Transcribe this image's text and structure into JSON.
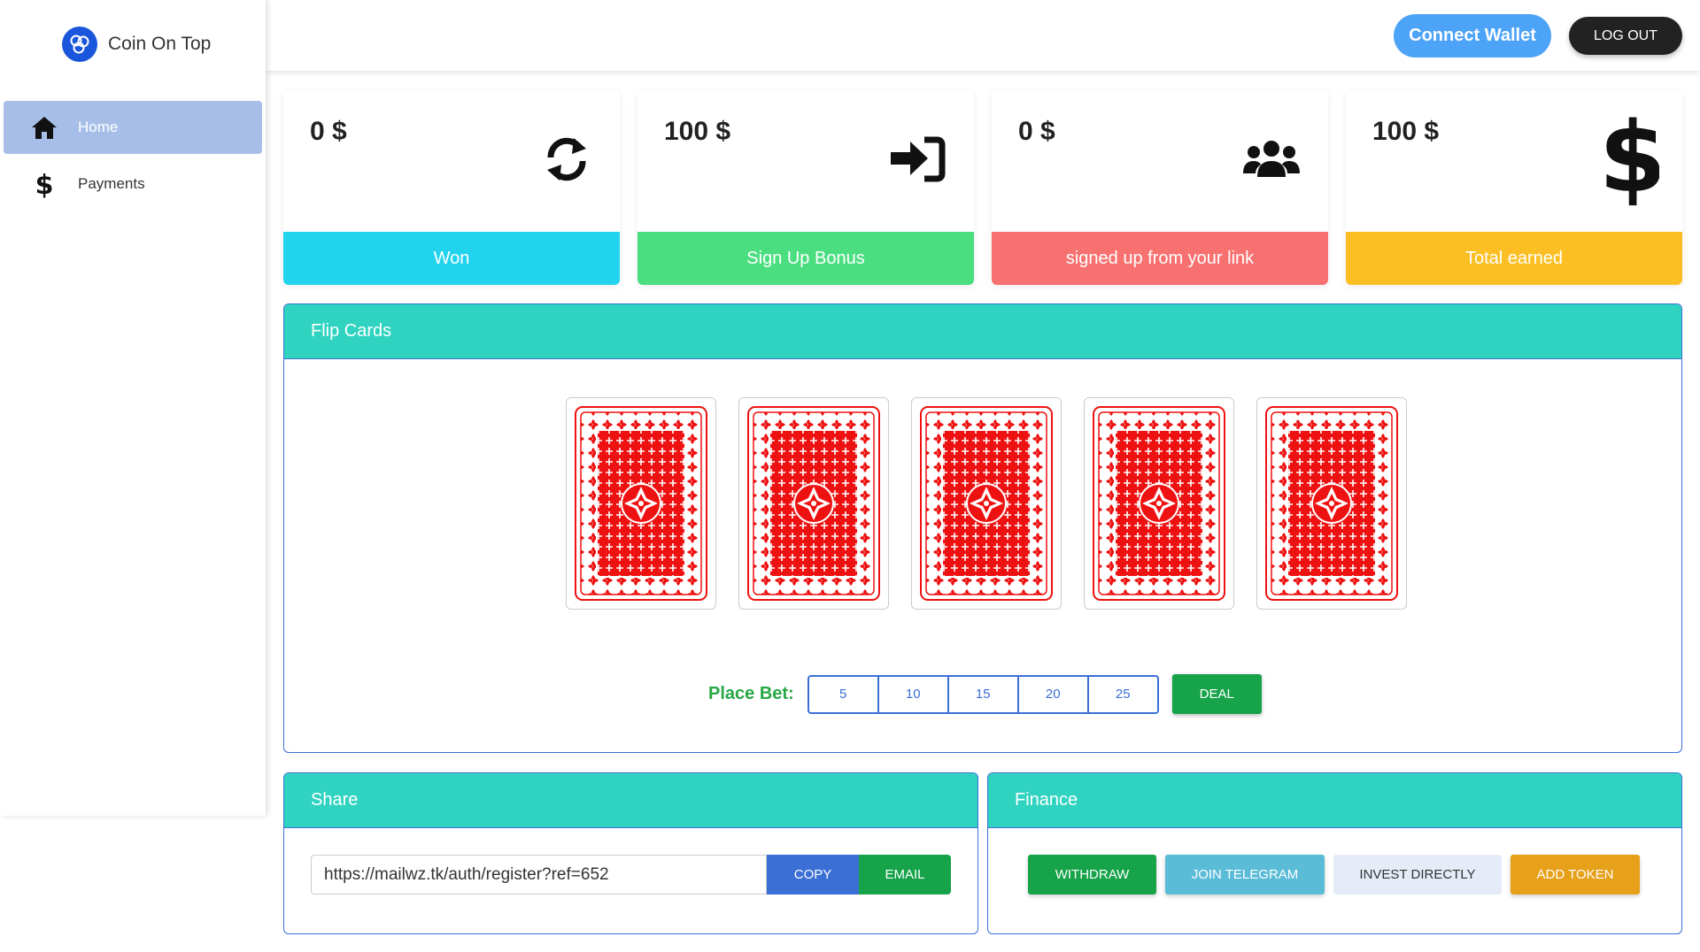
{
  "brand": {
    "name": "Coin On Top",
    "icon": "coins-icon",
    "color": "#1a56db"
  },
  "sidebar": {
    "items": [
      {
        "label": "Home",
        "icon": "home-icon",
        "active": true
      },
      {
        "label": "Payments",
        "icon": "dollar-icon",
        "active": false
      }
    ]
  },
  "header": {
    "connect_wallet": "Connect Wallet",
    "logout": "LOG OUT"
  },
  "stats": [
    {
      "value": "0 $",
      "label": "Won",
      "icon": "refresh-icon",
      "color": "#22d3ee"
    },
    {
      "value": "100 $",
      "label": "Sign Up Bonus",
      "icon": "sign-in-icon",
      "color": "#4ade80"
    },
    {
      "value": "0 $",
      "label": "signed up from your link",
      "icon": "users-icon",
      "color": "#f87171"
    },
    {
      "value": "100 $",
      "label": "Total earned",
      "icon": "dollar-icon",
      "color": "#fbbf24"
    }
  ],
  "flip_cards": {
    "title": "Flip Cards",
    "card_count": 5,
    "place_bet_label": "Place Bet:",
    "bets": [
      "5",
      "10",
      "15",
      "20",
      "25"
    ],
    "deal": "DEAL"
  },
  "share": {
    "title": "Share",
    "link": "https://mailwz.tk/auth/register?ref=652",
    "copy": "COPY",
    "email": "EMAIL"
  },
  "finance": {
    "title": "Finance",
    "withdraw": "WITHDRAW",
    "join_telegram": "JOIN TELEGRAM",
    "invest_directly": "INVEST DIRECTLY",
    "add_token": "ADD TOKEN"
  },
  "colors": {
    "accent_teal": "#2fd3c0",
    "primary_blue": "#3b6fd6",
    "success_green": "#16a34a"
  }
}
